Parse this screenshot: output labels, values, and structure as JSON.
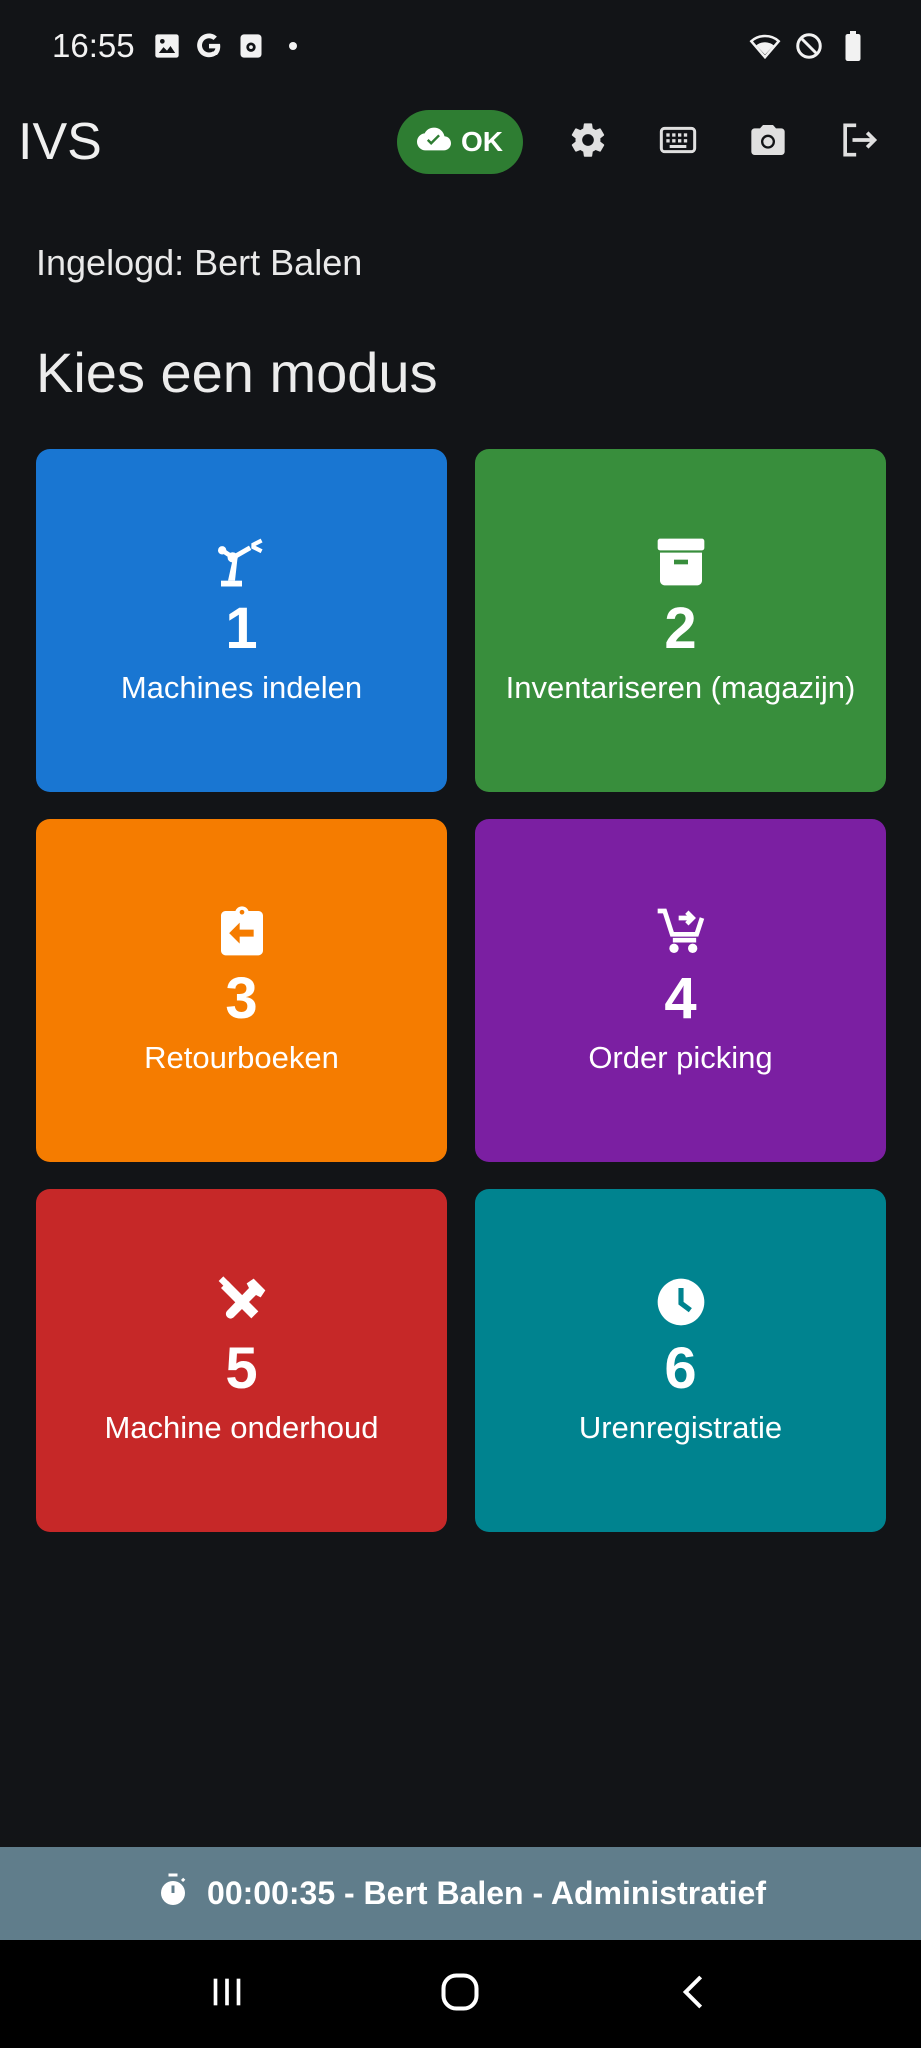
{
  "status_bar": {
    "time": "16:55",
    "notification_icons": [
      "image-icon",
      "google-icon",
      "app-icon",
      "dot-icon"
    ],
    "system_icons": [
      "wifi-icon",
      "do-not-disturb-icon",
      "battery-icon"
    ]
  },
  "app_bar": {
    "title": "IVS",
    "sync_status_label": "OK",
    "actions": [
      "settings-icon",
      "keyboard-icon",
      "camera-icon",
      "logout-icon"
    ]
  },
  "user": {
    "logged_in_text": "Ingelogd: Bert Balen"
  },
  "mode_section": {
    "heading": "Kies een modus",
    "tiles": [
      {
        "number": "1",
        "label": "Machines indelen",
        "icon": "robot-arm-icon",
        "color": "#1976d2"
      },
      {
        "number": "2",
        "label": "Inventariseren (magazijn)",
        "icon": "archive-box-icon",
        "color": "#388e3c"
      },
      {
        "number": "3",
        "label": "Retourboeken",
        "icon": "clipboard-return-icon",
        "color": "#f57c00"
      },
      {
        "number": "4",
        "label": "Order picking",
        "icon": "cart-add-icon",
        "color": "#7b1fa2"
      },
      {
        "number": "5",
        "label": "Machine onderhoud",
        "icon": "tools-icon",
        "color": "#c62828"
      },
      {
        "number": "6",
        "label": "Urenregistratie",
        "icon": "clock-icon",
        "color": "#00838f"
      }
    ]
  },
  "timer_bar": {
    "text": "00:00:35 - Bert Balen - Administratief",
    "icon": "stopwatch-icon",
    "color": "#607d8b"
  },
  "nav_bar": {
    "buttons": [
      "recent-apps-icon",
      "home-icon",
      "back-icon"
    ]
  },
  "colors": {
    "background": "#121417",
    "ok_chip": "#2e7d32"
  }
}
